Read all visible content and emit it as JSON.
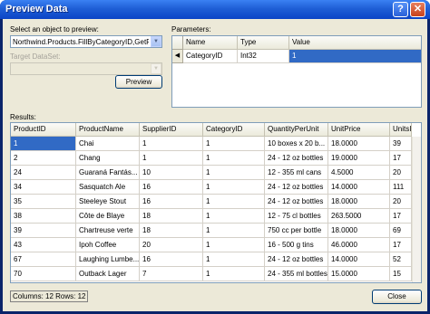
{
  "window": {
    "title": "Preview Data",
    "help_glyph": "?",
    "close_glyph": "✕"
  },
  "left_panel": {
    "select_label": "Select an object to preview:",
    "object_value": "Northwind.Products.FillByCategoryID,GetProd",
    "target_label": "Target DataSet:",
    "target_value": "",
    "preview_button": "Preview"
  },
  "parameters": {
    "label": "Parameters:",
    "columns": [
      "Name",
      "Type",
      "Value"
    ],
    "rows": [
      {
        "marker": "◀",
        "name": "CategoryID",
        "type": "Int32",
        "value": "1"
      }
    ]
  },
  "results": {
    "label": "Results:",
    "columns": [
      "ProductID",
      "ProductName",
      "SupplierID",
      "CategoryID",
      "QuantityPerUnit",
      "UnitPrice",
      "UnitsI"
    ],
    "rows": [
      [
        "1",
        "Chai",
        "1",
        "1",
        "10 boxes x 20 b...",
        "18.0000",
        "39"
      ],
      [
        "2",
        "Chang",
        "1",
        "1",
        "24 - 12 oz bottles",
        "19.0000",
        "17"
      ],
      [
        "24",
        "Guaraná Fantás...",
        "10",
        "1",
        "12 - 355 ml cans",
        "4.5000",
        "20"
      ],
      [
        "34",
        "Sasquatch Ale",
        "16",
        "1",
        "24 - 12 oz bottles",
        "14.0000",
        "111"
      ],
      [
        "35",
        "Steeleye Stout",
        "16",
        "1",
        "24 - 12 oz bottles",
        "18.0000",
        "20"
      ],
      [
        "38",
        "Côte de Blaye",
        "18",
        "1",
        "12 - 75 cl bottles",
        "263.5000",
        "17"
      ],
      [
        "39",
        "Chartreuse verte",
        "18",
        "1",
        "750 cc per bottle",
        "18.0000",
        "69"
      ],
      [
        "43",
        "Ipoh Coffee",
        "20",
        "1",
        "16 - 500 g tins",
        "46.0000",
        "17"
      ],
      [
        "67",
        "Laughing Lumbe...",
        "16",
        "1",
        "24 - 12 oz bottles",
        "14.0000",
        "52"
      ],
      [
        "70",
        "Outback Lager",
        "7",
        "1",
        "24 - 355 ml bottles",
        "15.0000",
        "15"
      ]
    ]
  },
  "status": {
    "text": "Columns: 12    Rows: 12"
  },
  "close_button": "Close"
}
